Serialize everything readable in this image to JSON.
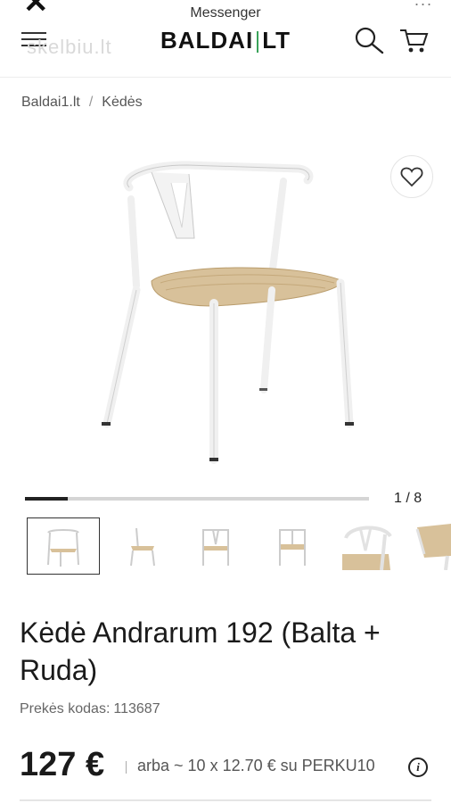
{
  "browser": {
    "close_icon": "close-icon",
    "messenger_label": "Messenger",
    "menu_dots": "..."
  },
  "header": {
    "logo_left": "BALDAI",
    "logo_right": "LT",
    "watermark": "skelbiu.lt",
    "icons": [
      "menu-icon",
      "search-icon",
      "cart-icon"
    ]
  },
  "breadcrumb": {
    "home": "Baldai1.lt",
    "separator": "/",
    "current": "Kėdės"
  },
  "gallery": {
    "counter": "1 / 8",
    "current": 1,
    "total": 8,
    "progress": 0.125,
    "thumbnails": 6
  },
  "product": {
    "title": "Kėdė Andrarum 192 (Balta + Ruda)",
    "code_label": "Prekės kodas:",
    "code_value": "113687",
    "price": "127 €",
    "installment": "arba ~ 10 x 12.70 € su PERKU10",
    "info_icon": "i"
  },
  "colors": {
    "accent": "#3aa35a",
    "chair_frame": "#f2f2f2",
    "seat": "#d8c19a"
  }
}
